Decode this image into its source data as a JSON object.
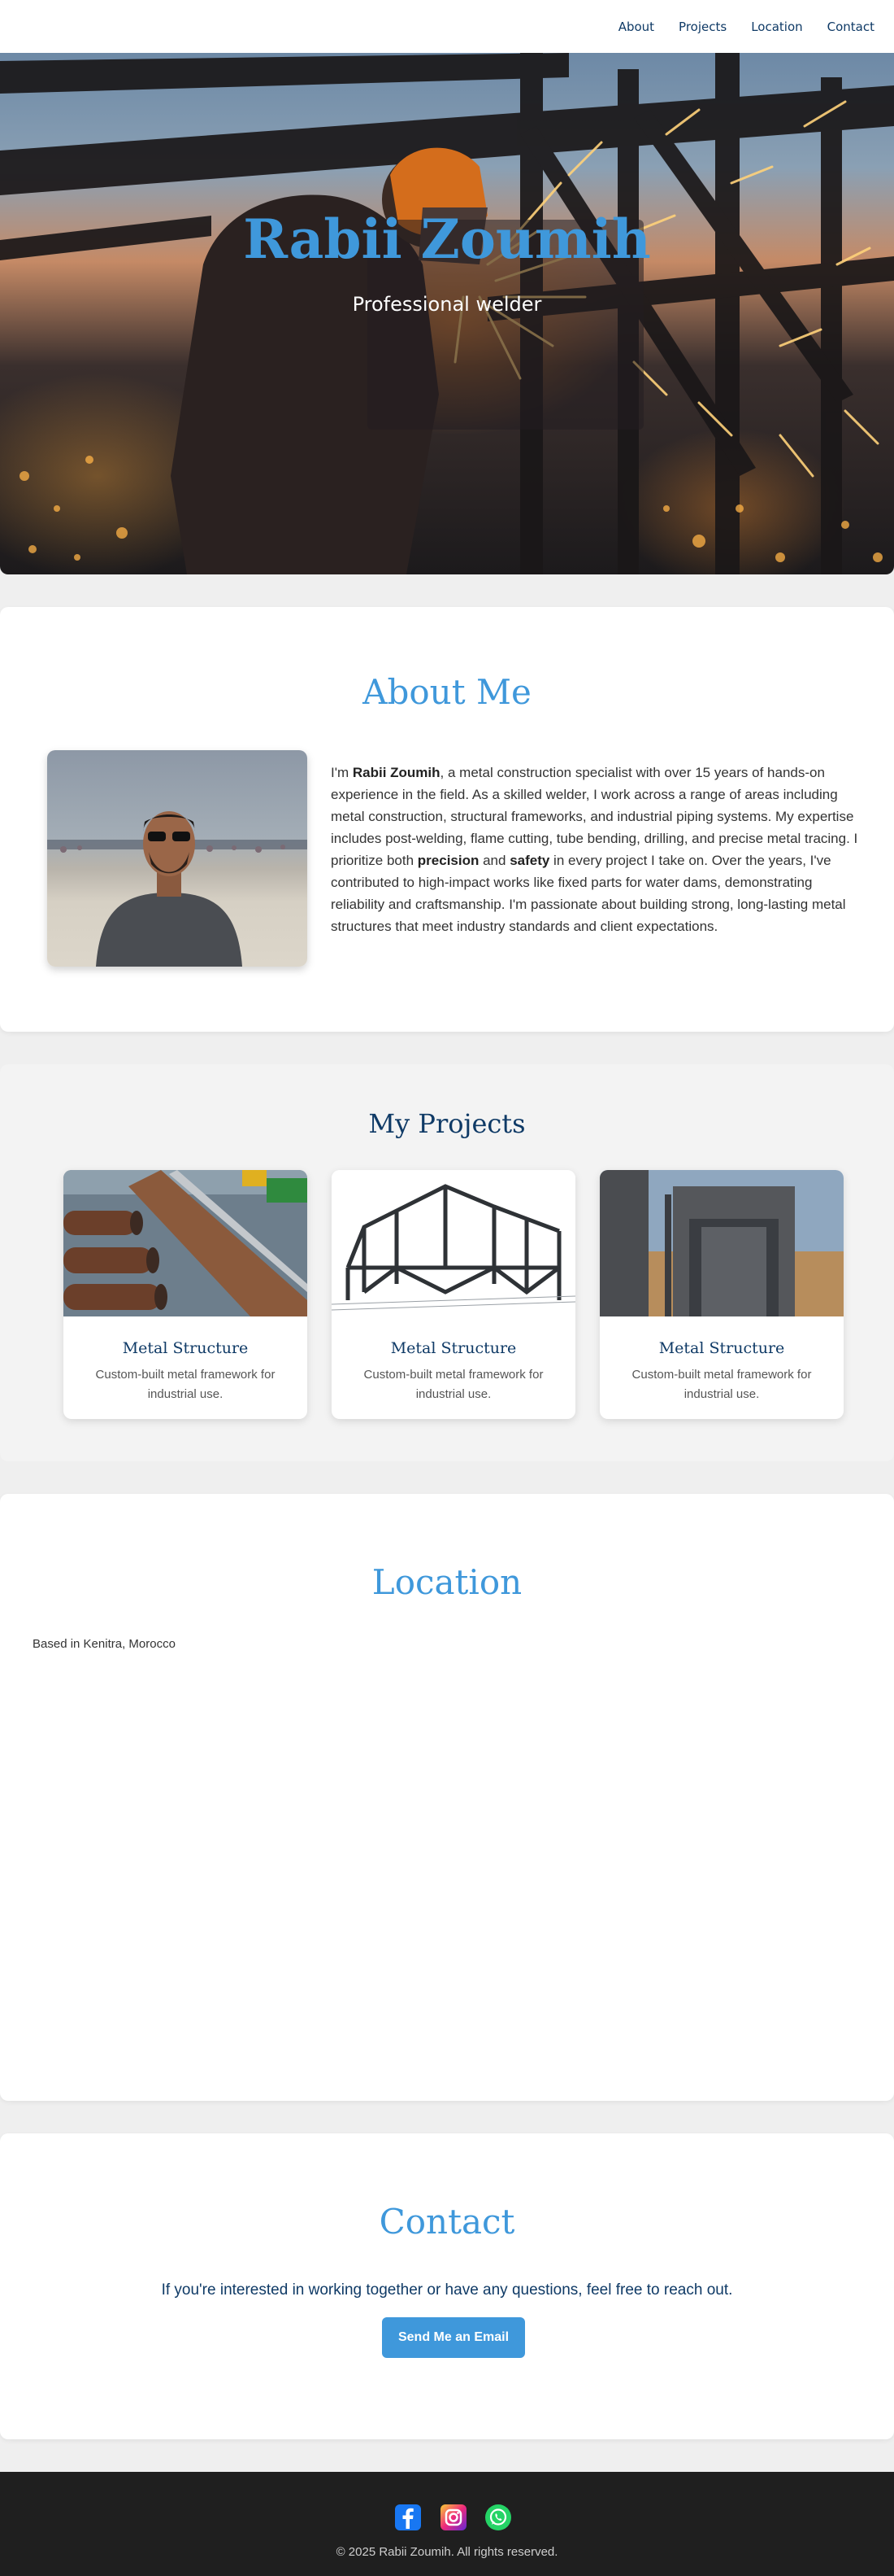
{
  "nav": {
    "items": [
      {
        "label": "About"
      },
      {
        "label": "Projects"
      },
      {
        "label": "Location"
      },
      {
        "label": "Contact"
      }
    ]
  },
  "hero": {
    "title": "Rabii Zoumih",
    "subtitle": "Professional welder"
  },
  "about": {
    "title": "About Me",
    "p1": "I'm ",
    "name": "Rabii Zoumih",
    "p2": ", a metal construction specialist with over 15 years of hands-on experience in the field. As a skilled welder, I work across a range of areas including metal construction, structural frameworks, and industrial piping systems. My expertise includes post-welding, flame cutting, tube bending, drilling, and precise metal tracing. I prioritize both ",
    "precision": "precision",
    "and": " and ",
    "safety": "safety",
    "p3": " in every project I take on. Over the years, I've contributed to high-impact works like fixed parts for water dams, demonstrating reliability and craftsmanship. I'm passionate about building strong, long-lasting metal structures that meet industry standards and client expectations."
  },
  "projects": {
    "title": "My Projects",
    "items": [
      {
        "title": "Metal Structure",
        "description": "Custom-built metal framework for industrial use."
      },
      {
        "title": "Metal Structure",
        "description": "Custom-built metal framework for industrial use."
      },
      {
        "title": "Metal Structure",
        "description": "Custom-built metal framework for industrial use."
      }
    ]
  },
  "location": {
    "title": "Location",
    "text": "Based in Kenitra, Morocco"
  },
  "contact": {
    "title": "Contact",
    "text": "If you're interested in working together or have any questions, feel free to reach out.",
    "button": "Send Me an Email"
  },
  "footer": {
    "copyright": "© 2025 Rabii Zoumih. All rights reserved.",
    "social": [
      "facebook-icon",
      "instagram-icon",
      "whatsapp-icon"
    ]
  },
  "colors": {
    "accent": "#3f98db",
    "navy": "#0f3a66",
    "footer": "#1f1f1f"
  }
}
